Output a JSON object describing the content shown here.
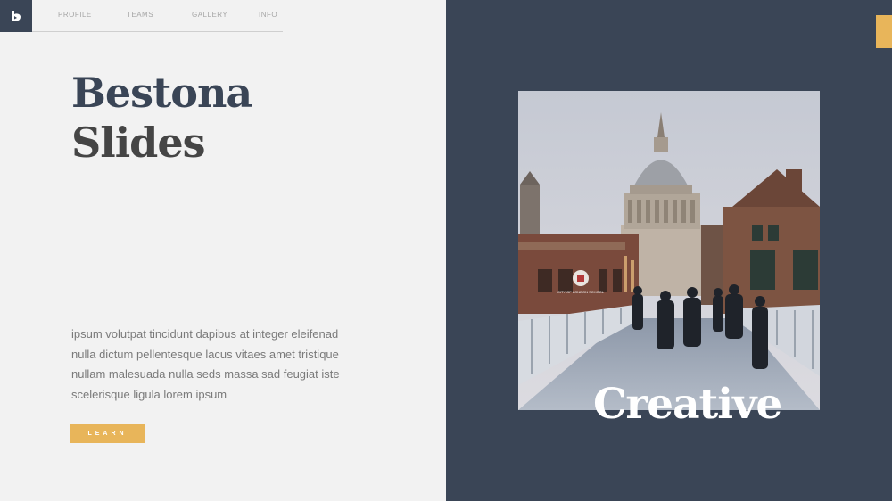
{
  "nav": {
    "items": [
      {
        "label": "PROFILE"
      },
      {
        "label": "TEAMS"
      },
      {
        "label": "GALLERY"
      },
      {
        "label": "INFO"
      }
    ]
  },
  "hero": {
    "title_line1": "Bestona",
    "title_line2": "Slides",
    "body": "ipsum volutpat tincidunt dapibus at integer eleifenad nulla dictum pellentesque lacus vitaes amet tristique nullam malesuada nulla seds massa sad feugiat iste scelerisque ligula lorem ipsum",
    "button_label": "LEARN"
  },
  "photo": {
    "overlay_text": "Creative",
    "sign_text": "CITY OF LONDON SCHOOL"
  },
  "colors": {
    "navy": "#3a4556",
    "accent": "#e8b55a",
    "background": "#f2f2f2"
  },
  "icons": {
    "logo": "brand-logo-icon"
  }
}
